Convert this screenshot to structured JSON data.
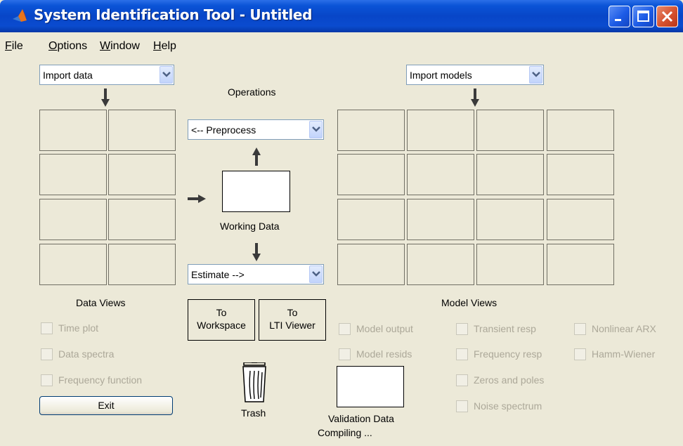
{
  "window": {
    "title": "System Identification Tool - Untitled"
  },
  "menu": [
    {
      "mnemonic": "F",
      "rest": "ile"
    },
    {
      "mnemonic": "O",
      "rest": "ptions"
    },
    {
      "mnemonic": "W",
      "rest": "indow"
    },
    {
      "mnemonic": "H",
      "rest": "elp"
    }
  ],
  "data_panel": {
    "import_value": "Import data",
    "views_label": "Data Views",
    "checkboxes": [
      "Time plot",
      "Data spectra",
      "Frequency function"
    ],
    "exit_label": "Exit"
  },
  "operations": {
    "label": "Operations",
    "preprocess_value": "<-- Preprocess",
    "working_data_label": "Working Data",
    "estimate_value": "Estimate -->",
    "to_workspace": [
      "To",
      "Workspace"
    ],
    "to_lti_viewer": [
      "To",
      "LTI Viewer"
    ],
    "trash_label": "Trash"
  },
  "model_panel": {
    "import_value": "Import models",
    "views_label": "Model Views",
    "checkboxes_col1": [
      "Model output",
      "Model resids"
    ],
    "checkboxes_col2": [
      "Transient resp",
      "Frequency resp",
      "Zeros and poles",
      "Noise spectrum"
    ],
    "checkboxes_col3": [
      "Nonlinear ARX",
      "Hamm-Wiener"
    ],
    "validation_label": "Validation Data",
    "status_text": "Compiling ..."
  },
  "colors": {
    "titlebar": "#0a53d6",
    "face": "#ece9d8",
    "disabled_text": "#aca899",
    "combo_border": "#7f9db9"
  },
  "icons": [
    "matlab-logo-icon",
    "minimize-icon",
    "maximize-icon",
    "close-icon",
    "trash-bin-icon",
    "arrow-down-icon",
    "arrow-up-icon",
    "arrow-right-icon"
  ]
}
